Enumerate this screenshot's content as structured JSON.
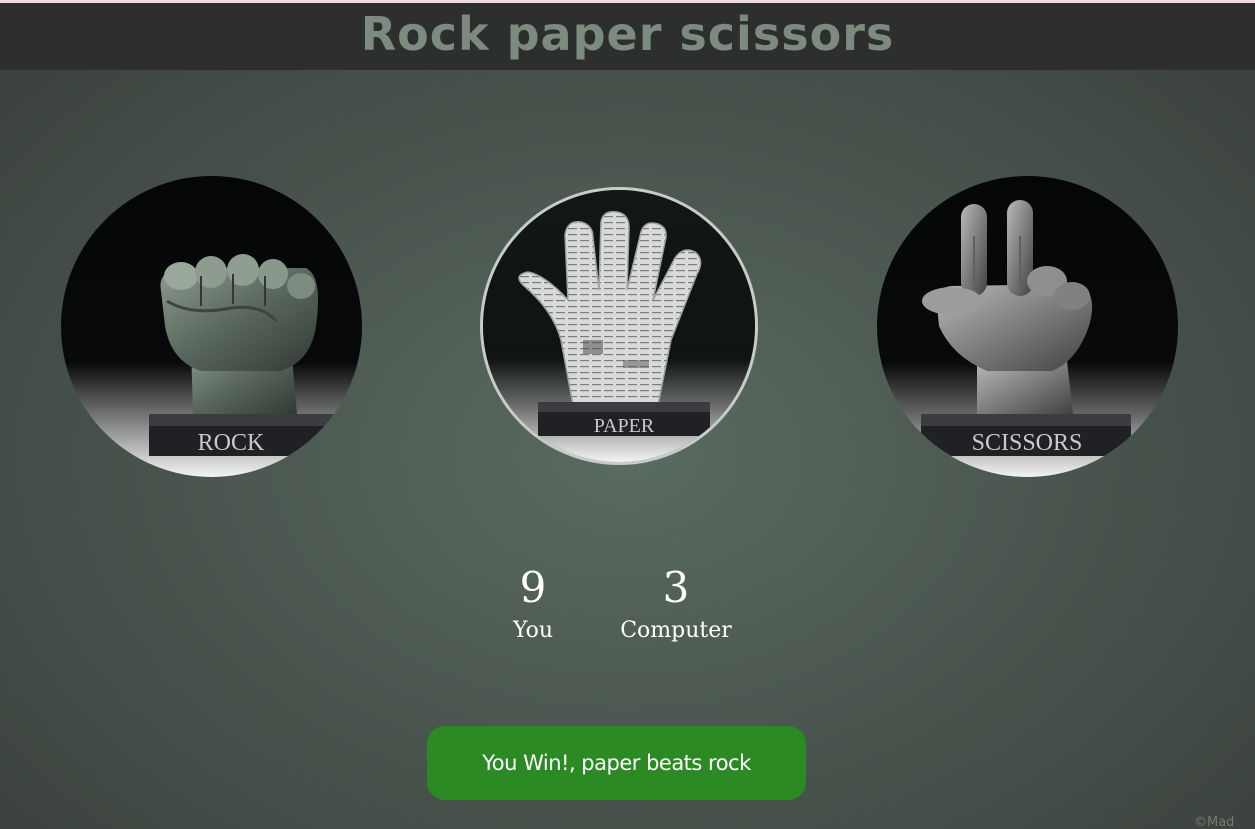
{
  "header": {
    "title": "Rock paper scissors"
  },
  "choices": {
    "rock": {
      "label": "ROCK"
    },
    "paper": {
      "label": "PAPER"
    },
    "scissors": {
      "label": "SCISSORS"
    }
  },
  "scoreboard": {
    "user": {
      "score": "9",
      "label": "You"
    },
    "computer": {
      "score": "3",
      "label": "Computer"
    }
  },
  "result": {
    "message": "You Win!, paper beats rock",
    "color": "#2b8a24"
  },
  "footer": {
    "credit": "©Mad"
  },
  "colors": {
    "title": "#7d8a80",
    "title_bar": "#2d2f2e",
    "background": "#4b5750"
  }
}
